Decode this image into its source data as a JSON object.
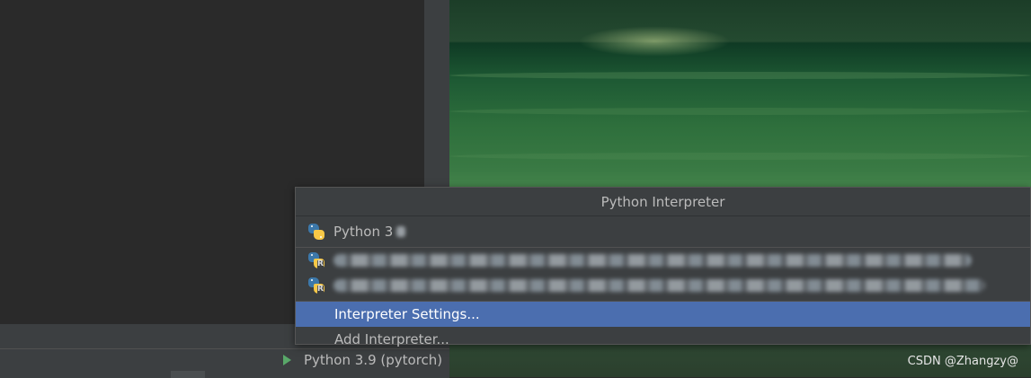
{
  "popup": {
    "title": "Python Interpreter",
    "items": [
      {
        "label": "Python 3",
        "icon": "python-icon"
      },
      {
        "label": "",
        "icon": "python-remote-icon",
        "badge": "R"
      },
      {
        "label": "",
        "icon": "python-remote-icon",
        "badge": "R"
      }
    ],
    "actions": [
      {
        "label": "Interpreter Settings..."
      },
      {
        "label": "Add Interpreter..."
      }
    ]
  },
  "statusbar": {
    "interpreter_label": "Python 3.9 (pytorch)",
    "icon": "play-icon"
  },
  "watermark": "CSDN @Zhangzy@",
  "colors": {
    "selection": "#4b6eaf",
    "popup_bg": "#3c3f41",
    "text": "#bbbbbb",
    "python_blue": "#3c78aa",
    "python_yellow": "#f7c847"
  }
}
